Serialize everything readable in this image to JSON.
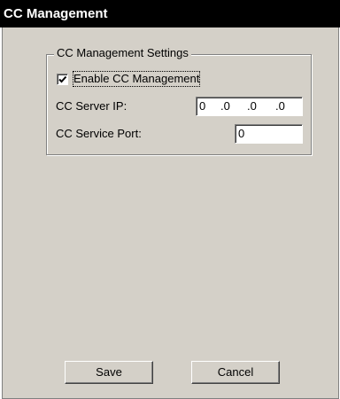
{
  "window": {
    "title": "CC Management"
  },
  "settings_group": {
    "legend": "CC Management Settings",
    "enable_checkbox": {
      "label": "Enable CC Management",
      "checked": true
    },
    "server_ip": {
      "label": "CC Server IP:",
      "octets": [
        "0",
        ".0",
        ".0",
        ".0"
      ]
    },
    "service_port": {
      "label": "CC Service Port:",
      "value": "0"
    }
  },
  "buttons": {
    "save_label": "Save",
    "cancel_label": "Cancel"
  },
  "colors": {
    "titlebar": "#000000",
    "face": "#d4d0c8",
    "shadow": "#808080",
    "highlight": "#ffffff"
  }
}
